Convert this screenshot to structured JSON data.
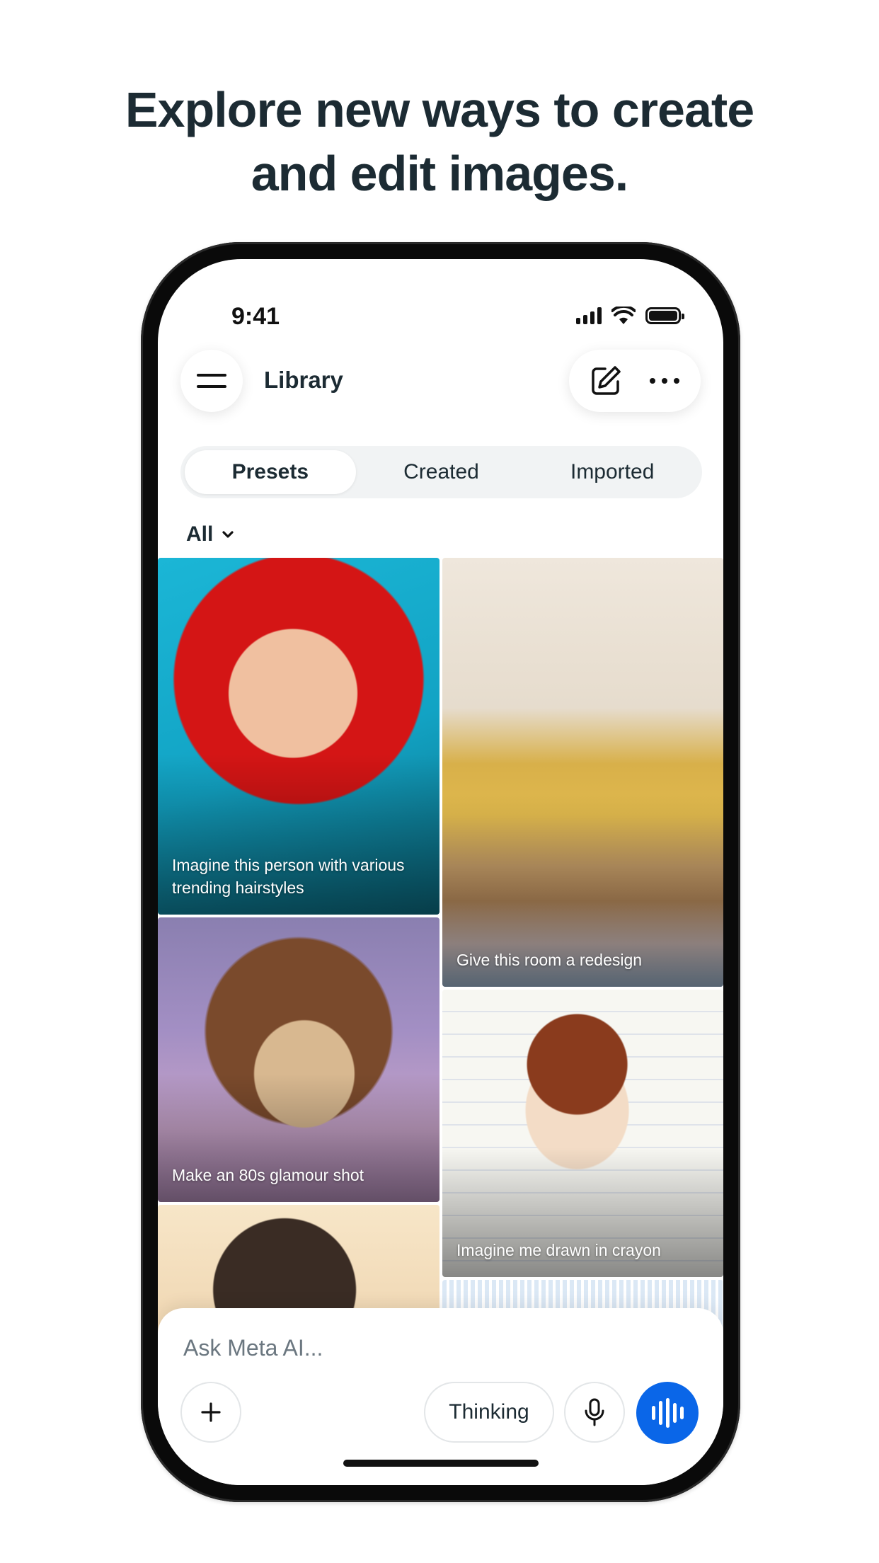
{
  "headline": {
    "line1": "Explore new ways to create",
    "line2": "and edit images."
  },
  "status_bar": {
    "time": "9:41",
    "icons": [
      "signal-icon",
      "wifi-icon",
      "battery-icon"
    ]
  },
  "header": {
    "title": "Library",
    "menu_icon": "hamburger-menu-icon",
    "compose_icon": "edit-icon",
    "more_icon": "more-horizontal-icon"
  },
  "tabs": [
    {
      "label": "Presets",
      "active": true
    },
    {
      "label": "Created",
      "active": false
    },
    {
      "label": "Imported",
      "active": false
    }
  ],
  "filter": {
    "label": "All",
    "icon": "chevron-down-icon"
  },
  "presets": [
    {
      "caption": "Imagine this person with various trending hairstyles"
    },
    {
      "caption": "Give this room a redesign"
    },
    {
      "caption": "Make an 80s glamour shot"
    },
    {
      "caption": "Imagine me drawn in crayon"
    },
    {
      "caption": ""
    },
    {
      "caption": ""
    }
  ],
  "composer": {
    "placeholder": "Ask Meta AI...",
    "thinking_label": "Thinking",
    "accent_color": "#0a66e8",
    "icons": [
      "plus-icon",
      "microphone-icon",
      "voice-waveform-icon"
    ]
  }
}
